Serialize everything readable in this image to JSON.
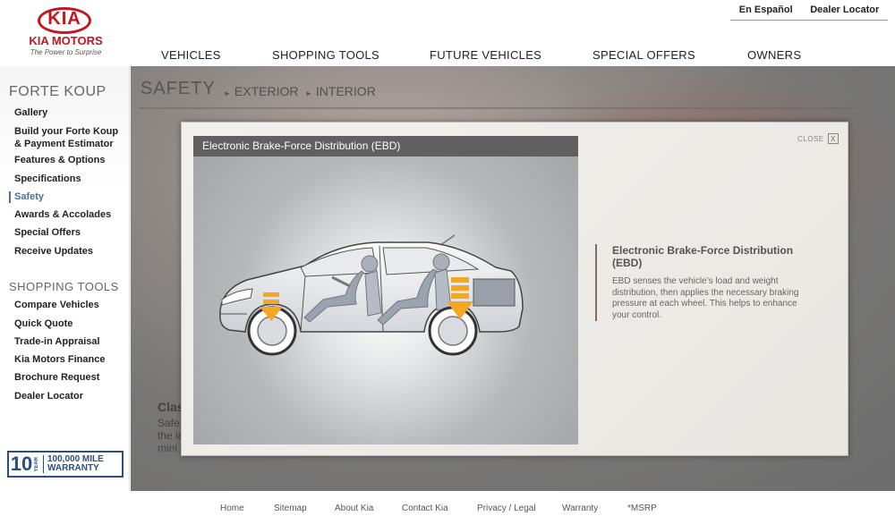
{
  "brand": {
    "logo_text": "KIA",
    "name": "KIA MOTORS",
    "tagline": "The Power to Surprise"
  },
  "top_links": {
    "espanol": "En Español",
    "dealer_locator": "Dealer Locator"
  },
  "main_nav": [
    "VEHICLES",
    "SHOPPING TOOLS",
    "FUTURE VEHICLES",
    "SPECIAL OFFERS",
    "OWNERS"
  ],
  "sidebar": {
    "model_heading": "FORTE KOUP",
    "model_items": [
      "Gallery",
      "Build your Forte Koup",
      "& Payment Estimator",
      "Features & Options",
      "Specifications",
      "Safety",
      "Awards & Accolades",
      "Special Offers",
      "Receive Updates"
    ],
    "active_item": "Safety",
    "shopping_heading": "SHOPPING TOOLS",
    "shopping_items": [
      "Compare Vehicles",
      "Quick Quote",
      "Trade-in Appraisal",
      "Kia Motors Finance",
      "Brochure Request",
      "Dealer Locator"
    ],
    "warranty": {
      "number": "10",
      "year": "YEAR",
      "line1": "100,000 MILE",
      "line2": "WARRANTY"
    }
  },
  "page": {
    "title": "SAFETY",
    "breadcrumb": [
      "EXTERIOR",
      "INTERIOR"
    ],
    "background_heading": "Clas",
    "background_lines": [
      "Safe",
      "the la",
      "mini"
    ]
  },
  "modal": {
    "close_label": "CLOSE",
    "close_symbol": "X",
    "video_title": "Electronic Brake-Force Distribution (EBD)",
    "desc_title": "Electronic Brake-Force Distribution (EBD)",
    "desc_body": "EBD senses the vehicle’s load and weight distribution, then applies the necessary braking pressure at each wheel. This helps to enhance your control."
  },
  "footer_links": [
    "Home",
    "Sitemap",
    "About Kia",
    "Contact Kia",
    "Privacy / Legal",
    "Warranty",
    "*MSRP"
  ],
  "colors": {
    "brand_red": "#c4161c",
    "active_blue": "#4a6f9b",
    "arrow_orange": "#f5a623"
  }
}
